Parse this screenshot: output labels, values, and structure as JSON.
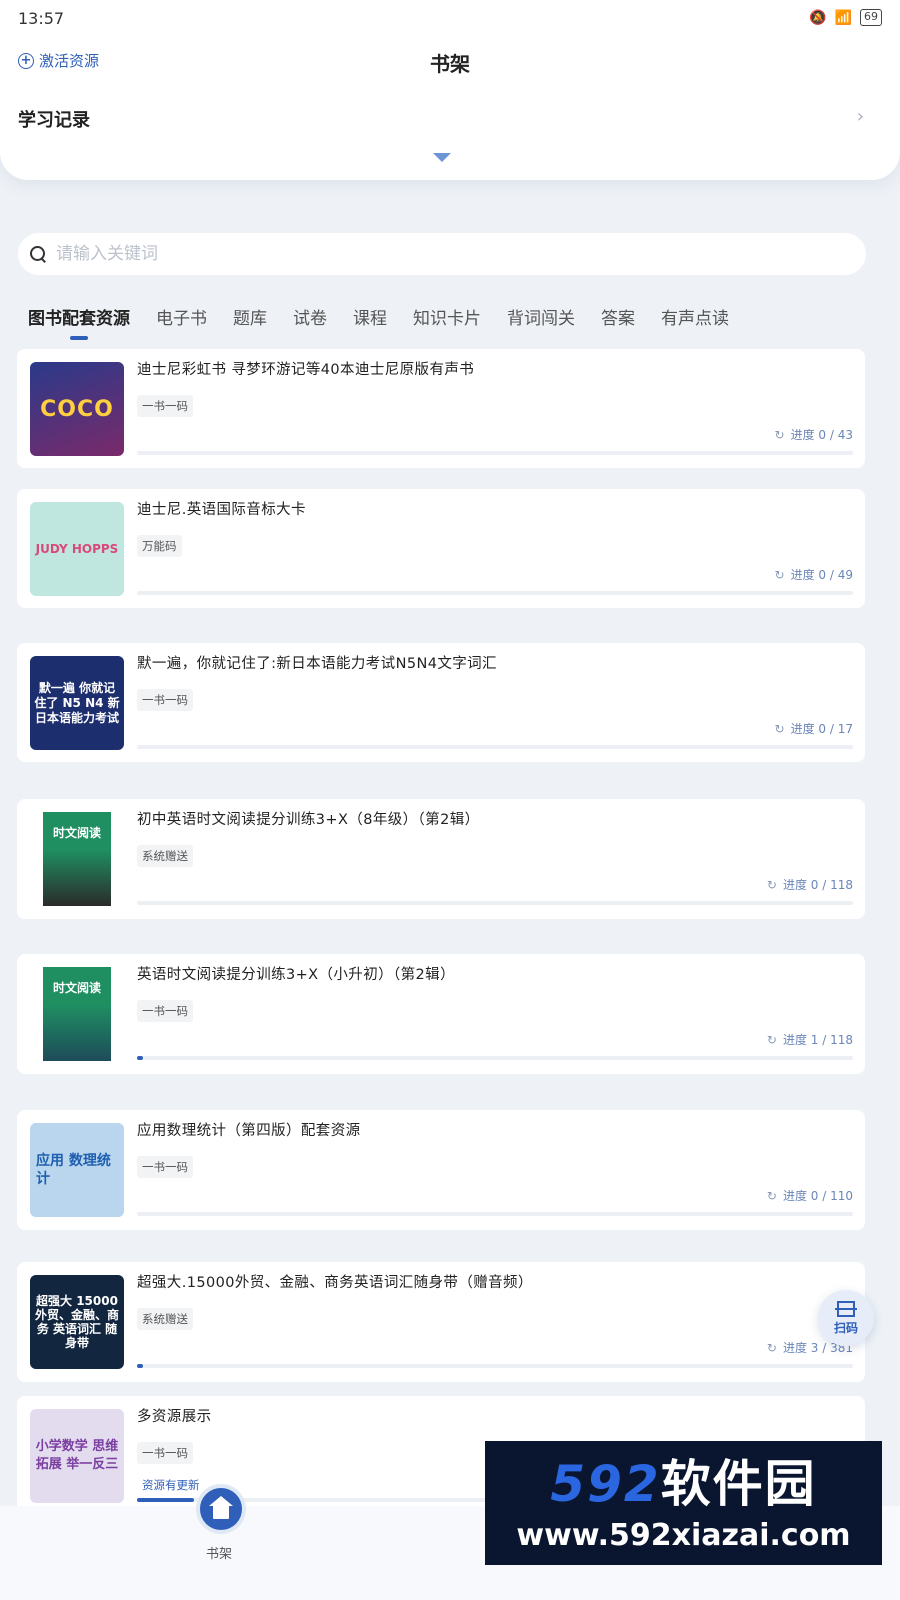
{
  "status_bar": {
    "time": "13:57",
    "battery": "69"
  },
  "header": {
    "activate_label": "激活资源",
    "title": "书架",
    "study_record": "学习记录"
  },
  "search": {
    "placeholder": "请输入关键词"
  },
  "tabs": [
    {
      "label": "图书配套资源",
      "active": true
    },
    {
      "label": "电子书"
    },
    {
      "label": "题库"
    },
    {
      "label": "试卷"
    },
    {
      "label": "课程"
    },
    {
      "label": "知识卡片"
    },
    {
      "label": "背词闯关"
    },
    {
      "label": "答案"
    },
    {
      "label": "有声点读"
    }
  ],
  "books": [
    {
      "title": "迪士尼彩虹书 寻梦环游记等40本迪士尼原版有声书",
      "tag": "一书一码",
      "progress_label": "进度 0 / 43",
      "progress": 0.0,
      "cover_text": "COCO",
      "cover_color": "#4a2a7a"
    },
    {
      "title": "迪士尼.英语国际音标大卡",
      "tag": "万能码",
      "progress_label": "进度 0 / 49",
      "progress": 0.0,
      "cover_text": "JUDY HOPPS",
      "cover_color": "#bfe6df"
    },
    {
      "title": "默一遍，你就记住了:新日本语能力考试N5N4文字词汇",
      "tag": "一书一码",
      "progress_label": "进度 0 / 17",
      "progress": 0.0,
      "cover_text": "默一遍 你就记住了 N5 N4 新日本语能力考试",
      "cover_color": "#1c2e6e"
    },
    {
      "title": "初中英语时文阅读提分训练3+X（8年级）（第2辑）",
      "tag": "系统赠送",
      "progress_label": "进度 0 / 118",
      "progress": 0.0,
      "cover_text": "时文阅读",
      "cover_color": "#1f8f62"
    },
    {
      "title": "英语时文阅读提分训练3+X（小升初）（第2辑）",
      "tag": "一书一码",
      "progress_label": "进度 1 / 118",
      "progress": 0.0085,
      "cover_text": "时文阅读",
      "cover_color": "#1f8f62"
    },
    {
      "title": "应用数理统计（第四版）配套资源",
      "tag": "一书一码",
      "progress_label": "进度 0 / 110",
      "progress": 0.0,
      "cover_text": "应用 数理统计",
      "cover_color": "#a9cbe8"
    },
    {
      "title": "超强大.15000外贸、金融、商务英语词汇随身带（赠音频）",
      "tag": "系统赠送",
      "progress_label": "进度 3 / 381",
      "progress": 0.008,
      "cover_text": "超强大 15000 外贸、金融、商务 英语词汇 随身带",
      "cover_color": "#12263f"
    },
    {
      "title": "多资源展示",
      "tag": "一书一码",
      "tag2": "资源有更新",
      "progress_label": "",
      "progress": 0.08,
      "cover_text": "小学数学 思维拓展 举一反三",
      "cover_color": "#e3dcef"
    }
  ],
  "scan": {
    "label": "扫码"
  },
  "nav": {
    "home_label": "书架"
  },
  "watermark": {
    "logo_num": "592",
    "logo_cn": "软件园",
    "url": "www.592xiazai.com"
  },
  "colors": {
    "accent": "#2f5fb8",
    "background": "#eef2f7"
  }
}
